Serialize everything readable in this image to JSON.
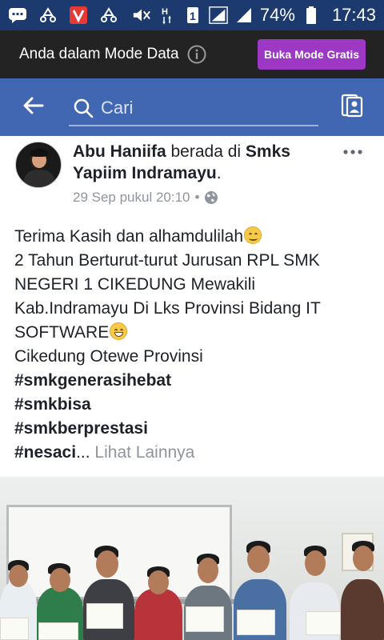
{
  "status_bar": {
    "battery_percent": "74%",
    "time": "17:43",
    "icons": [
      "message-icon",
      "sync-icon",
      "app-v-icon",
      "sync-icon",
      "mute-icon",
      "network-h-icon",
      "sim-1-icon",
      "signal-icon",
      "signal-icon",
      "battery-icon"
    ]
  },
  "data_banner": {
    "text": "Anda dalam Mode Data",
    "button_label": "Buka Mode Gratis",
    "button_color": "#9c38c4"
  },
  "header": {
    "search_placeholder": "Cari",
    "bar_color": "#4267b2"
  },
  "post": {
    "author": "Abu Haniifa",
    "connector": " berada di ",
    "place_line1": "Smks",
    "place_line2": "Yapiim Indramayu",
    "period": ".",
    "timestamp": "29 Sep pukul 20:10",
    "separator": " • ",
    "body": {
      "line1": "Terima Kasih dan alhamdulilah",
      "line2": "2 Tahun Berturut-turut Jurusan RPL SMK",
      "line3": "NEGERI 1 CIKEDUNG Mewakili",
      "line4": "Kab.Indramayu Di Lks Provinsi Bidang IT",
      "line5": "SOFTWARE",
      "line6": "Cikedung Otewe Provinsi",
      "hashtags": [
        "#smkgenerasihebat",
        "#smkbisa",
        "#smkberprestasi"
      ],
      "last_hashtag": "#nesaci",
      "ellipsis": "...",
      "see_more": "Lihat Lainnya"
    }
  }
}
